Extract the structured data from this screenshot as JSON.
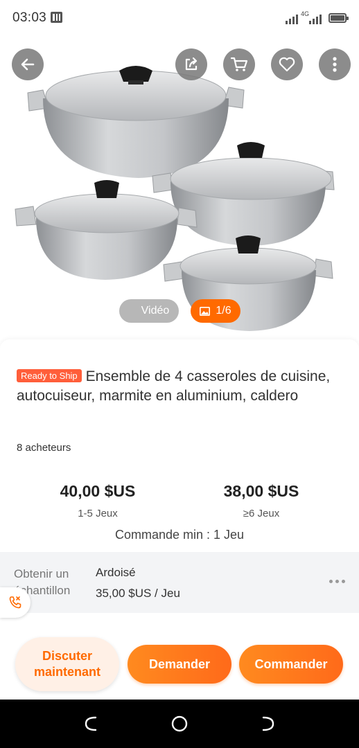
{
  "status_bar": {
    "time": "03:03",
    "network": "4G",
    "battery_level": 0.9
  },
  "gallery": {
    "video_label": "Vidéo",
    "image_counter": "1/6",
    "icons": [
      "back-arrow-icon",
      "share-icon",
      "cart-icon",
      "heart-icon",
      "more-vertical-icon"
    ]
  },
  "product": {
    "badge": "Ready to Ship",
    "title": "Ensemble de 4 casseroles de cuisine, autocuiseur, marmite en aluminium, caldero",
    "buyers": "8 acheteurs"
  },
  "pricing": {
    "tiers": [
      {
        "price": "40,00 $US",
        "quantity": "1-5 Jeux"
      },
      {
        "price": "38,00 $US",
        "quantity": "≥6 Jeux"
      }
    ],
    "min_order": "Commande min : 1 Jeu"
  },
  "sample": {
    "label": "Obtenir un échantillon",
    "name": "Ardoisé",
    "price": "35,00 $US / Jeu"
  },
  "actions": {
    "chat": "Discuter maintenant",
    "inquire": "Demander",
    "order": "Commander"
  },
  "colors": {
    "accent": "#ff6a00",
    "badge": "#ff5e3a",
    "chat_bg": "#fff0e6"
  }
}
